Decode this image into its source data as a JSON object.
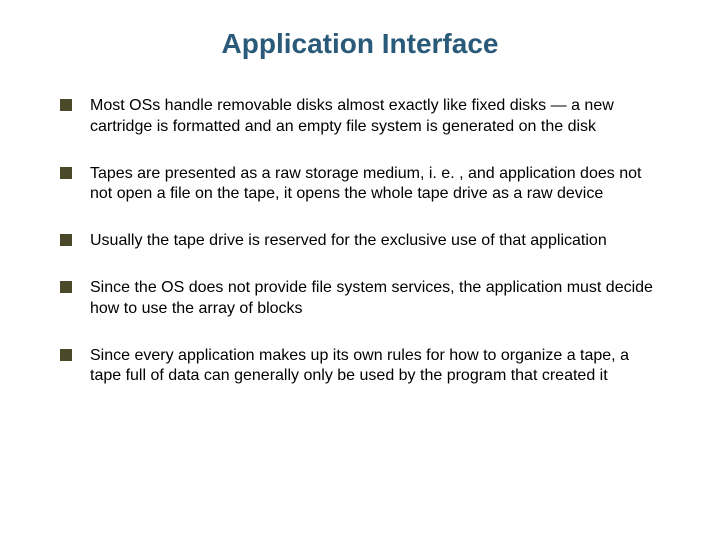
{
  "title": "Application Interface",
  "bullets": [
    "Most OSs handle removable disks almost exactly like fixed disks — a new cartridge is formatted and an empty file system is generated on the disk",
    "Tapes are presented as a raw storage medium, i. e. , and application does not not open a file on the tape, it opens the whole tape drive as a raw device",
    "Usually the tape drive is reserved for the exclusive use of that application",
    "Since the OS does not provide file system services, the application must decide how to use the array of blocks",
    "Since every application makes up its own rules for how to organize a tape, a tape full of data can generally only be used by the program that created it"
  ]
}
